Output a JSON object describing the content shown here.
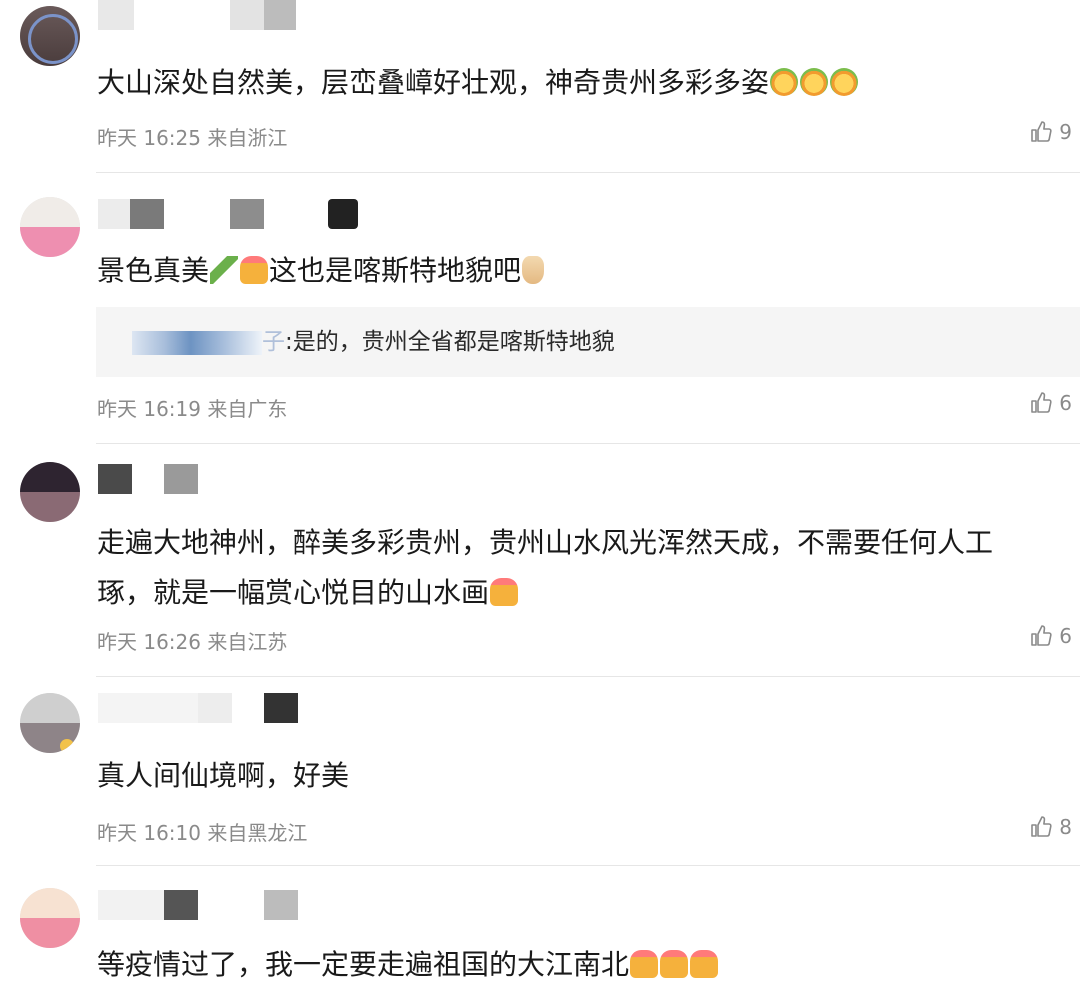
{
  "comments": [
    {
      "text": "大山深处自然美，层峦叠嶂好壮观，神奇贵州多彩多姿",
      "time": "昨天 16:25 来自浙江",
      "likes": "9",
      "emoji_after": [
        "flower-face-emoji",
        "flower-face-emoji",
        "flower-face-emoji"
      ]
    },
    {
      "text": "景色真美",
      "text2": "这也是喀斯特地貌吧",
      "reply": ":是的，贵州全省都是喀斯特地貌",
      "reply_suffix": "子",
      "time": "昨天 16:19 来自广东",
      "likes": "6"
    },
    {
      "text_line1": "走遍大地神州，醉美多彩贵州，贵州山水风光浑然天成，不需要任何人工",
      "text_line2": "琢，就是一幅赏心悦目的山水画",
      "time": "昨天 16:26 来自江苏",
      "likes": "6"
    },
    {
      "text": "真人间仙境啊，好美",
      "time": "昨天 16:10 来自黑龙江",
      "likes": "8"
    },
    {
      "text": "等疫情过了，我一定要走遍祖国的大江南北"
    }
  ],
  "colors": {
    "meta": "#8a8a8a",
    "reply_bg": "#f5f5f5",
    "divider": "#e6e6e6"
  }
}
